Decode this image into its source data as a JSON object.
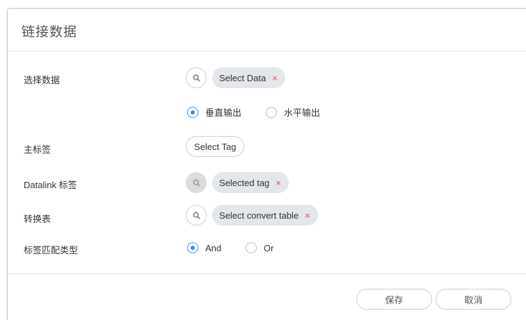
{
  "dialog": {
    "title": "链接数据"
  },
  "rows": {
    "select_data": {
      "label": "选择数据",
      "tag_text": "Select Data",
      "remove_symbol": "×"
    },
    "output_direction": {
      "options": [
        {
          "label": "垂直输出",
          "checked": true
        },
        {
          "label": "水平输出",
          "checked": false
        }
      ]
    },
    "main_tag": {
      "label": "主标签",
      "button_label": "Select Tag"
    },
    "datalink_tag": {
      "label": "Datalink 标签",
      "tag_text": "Selected tag",
      "remove_symbol": "×"
    },
    "convert_table": {
      "label": "转换表",
      "tag_text": "Select convert table",
      "remove_symbol": "×"
    },
    "match_type": {
      "label": "标签匹配类型",
      "options": [
        {
          "label": "And",
          "checked": true
        },
        {
          "label": "Or",
          "checked": false
        }
      ]
    }
  },
  "footer": {
    "save_label": "保存",
    "cancel_label": "取消"
  },
  "colors": {
    "accent": "#3d8fd8",
    "remove_red": "#e0505a",
    "tag_bg": "#e3e6ea"
  },
  "icons": {
    "search": "search-icon",
    "remove": "close-icon"
  }
}
